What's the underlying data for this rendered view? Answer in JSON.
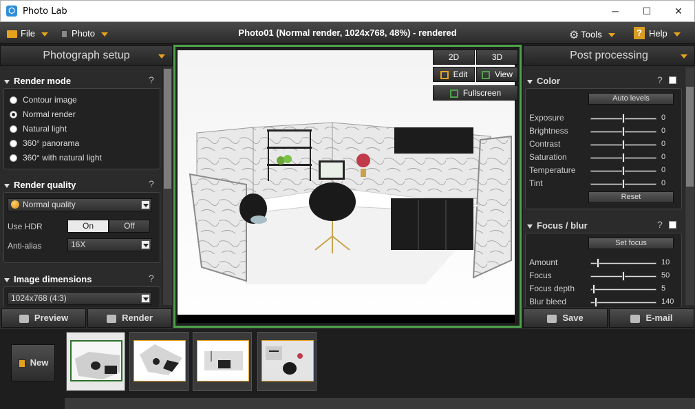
{
  "window": {
    "title": "Photo Lab",
    "minimize": "─",
    "maximize": "☐",
    "close": "✕"
  },
  "toolbar": {
    "file": "File",
    "photo": "Photo",
    "status": "Photo01 (Normal render, 1024x768, 48%) - rendered",
    "tools": "Tools",
    "help": "Help"
  },
  "left": {
    "header": "Photograph setup",
    "render_mode": {
      "title": "Render mode",
      "help": "?",
      "options": [
        "Contour image",
        "Normal render",
        "Natural light",
        "360° panorama",
        "360° with natural light"
      ],
      "selected": "Normal render"
    },
    "render_quality": {
      "title": "Render quality",
      "help": "?",
      "quality": "Normal quality",
      "use_hdr_label": "Use HDR",
      "on": "On",
      "off": "Off",
      "hdr_state": "On",
      "anti_alias_label": "Anti-alias",
      "anti_alias": "16X"
    },
    "image_dimensions": {
      "title": "Image dimensions",
      "help": "?",
      "value": "1024x768 (4:3)"
    },
    "preview": "Preview",
    "render": "Render"
  },
  "viewport": {
    "btn_2d": "2D",
    "btn_3d": "3D",
    "edit": "Edit",
    "view": "View",
    "fullscreen": "Fullscreen"
  },
  "right": {
    "header": "Post processing",
    "color": {
      "title": "Color",
      "help": "?",
      "auto_levels": "Auto levels",
      "reset": "Reset",
      "sliders": [
        {
          "label": "Exposure",
          "value": "0",
          "pos": 0.5
        },
        {
          "label": "Brightness",
          "value": "0",
          "pos": 0.5
        },
        {
          "label": "Contrast",
          "value": "0",
          "pos": 0.5
        },
        {
          "label": "Saturation",
          "value": "0",
          "pos": 0.5
        },
        {
          "label": "Temperature",
          "value": "0",
          "pos": 0.5
        },
        {
          "label": "Tint",
          "value": "0",
          "pos": 0.5
        }
      ]
    },
    "focus": {
      "title": "Focus / blur",
      "help": "?",
      "set_focus": "Set focus",
      "sliders": [
        {
          "label": "Amount",
          "value": "10",
          "pos": 0.1
        },
        {
          "label": "Focus",
          "value": "50",
          "pos": 0.5
        },
        {
          "label": "Focus depth",
          "value": "5",
          "pos": 0.03
        },
        {
          "label": "Blur bleed",
          "value": "140",
          "pos": 0.07
        }
      ]
    },
    "save": "Save",
    "email": "E-mail"
  },
  "gallery": {
    "new": "New",
    "thumbs": 4,
    "selected_index": 0
  }
}
